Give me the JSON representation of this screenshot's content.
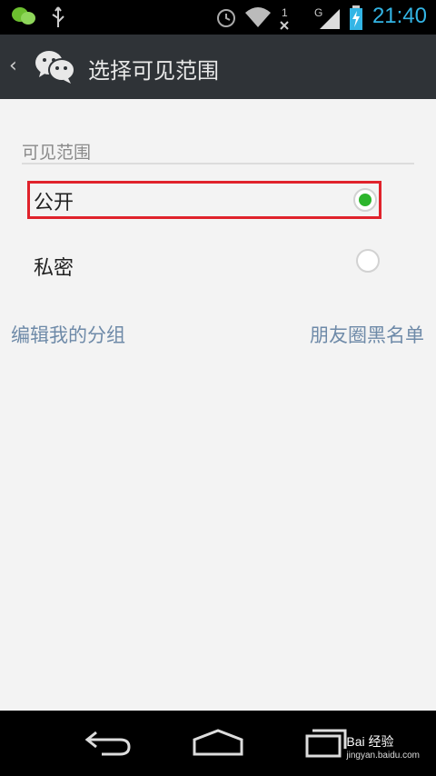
{
  "status_bar": {
    "time": "21:40",
    "network_label": "G",
    "icons": [
      "wechat-icon",
      "usb-icon",
      "alarm-icon",
      "wifi-icon",
      "no-signal-icon",
      "signal-icon",
      "battery-charging-icon"
    ]
  },
  "header": {
    "back_glyph": "‹",
    "title": "选择可见范围"
  },
  "visibility": {
    "section_title": "可见范围",
    "options": [
      {
        "label": "公开",
        "selected": true
      },
      {
        "label": "私密",
        "selected": false
      }
    ]
  },
  "links": {
    "left": "编辑我的分组",
    "right": "朋友圈黑名单"
  },
  "nav_bar": {
    "watermark": "Bai 经验",
    "watermark_sub": "jingyan.baidu.com"
  },
  "colors": {
    "accent_green": "#2db52d",
    "highlight_red": "#e0222b",
    "link_blue": "#6e8aa8",
    "clock_blue": "#33b5e5"
  }
}
